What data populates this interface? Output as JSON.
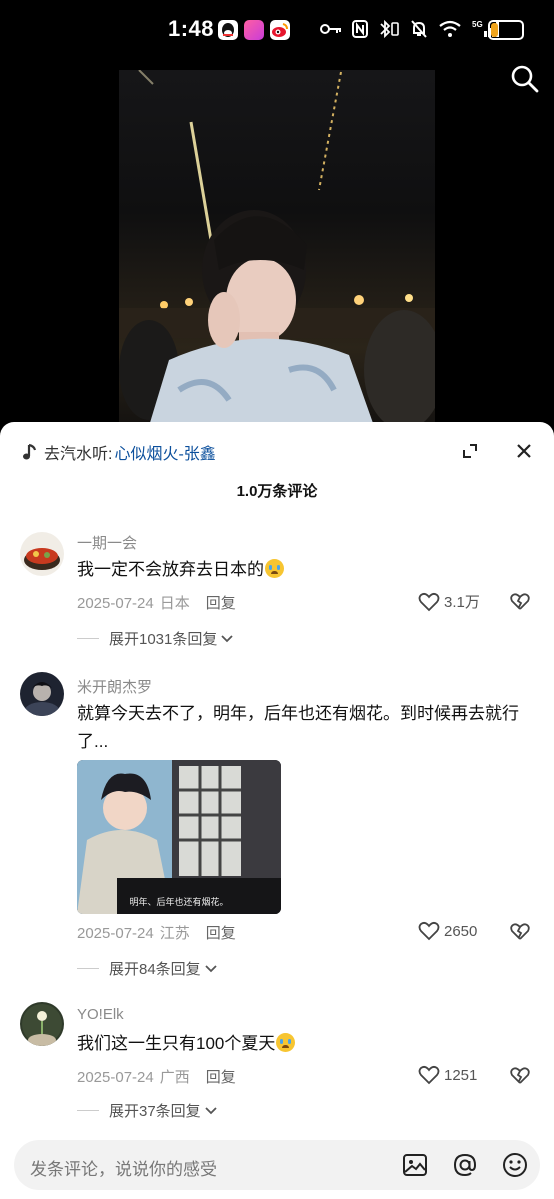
{
  "status": {
    "time": "1:48",
    "battery": "17"
  },
  "music": {
    "prefix": "去汽水听:",
    "song": "心似烟火-张鑫"
  },
  "comments_count": "1.0万条评论",
  "comments": [
    {
      "user": "一期一会",
      "text": "我一定不会放弃去日本的",
      "date": "2025-07-24",
      "location": "日本",
      "reply": "回复",
      "likes": "3.1万",
      "replies": "展开1031条回复"
    },
    {
      "user": "米开朗杰罗",
      "text": "就算今天去不了，明年，后年也还有烟花。到时候再去就行了...",
      "date": "2025-07-24",
      "location": "江苏",
      "reply": "回复",
      "likes": "2650",
      "replies": "展开84条回复",
      "image_caption": "明年、后年也还有烟花。"
    },
    {
      "user": "YO!Elk",
      "text": "我们这一生只有100个夏天",
      "date": "2025-07-24",
      "location": "广西",
      "reply": "回复",
      "likes": "1251",
      "replies": "展开37条回复"
    }
  ],
  "input": {
    "placeholder": "发条评论，说说你的感受"
  },
  "colors": {
    "accent_link": "#0b4f9c",
    "battery": "#f0a41c"
  }
}
